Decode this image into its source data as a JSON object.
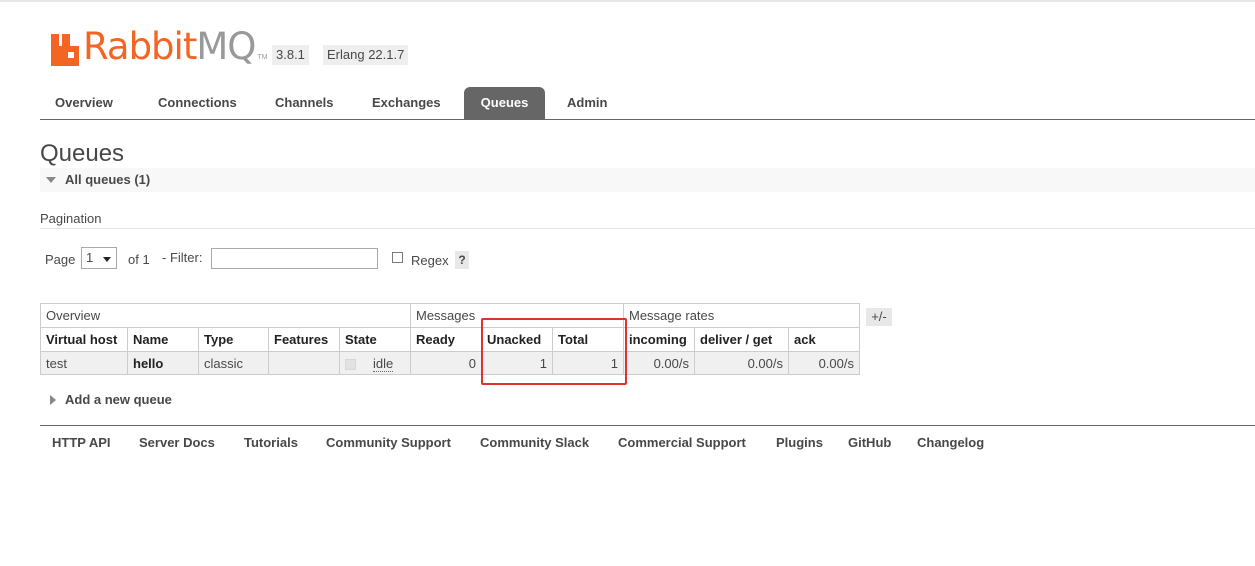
{
  "brand": {
    "name_part1": "Rabbit",
    "name_part2": "MQ",
    "trademark": "TM",
    "accent_color": "#f26522",
    "version": "3.8.1",
    "erlang": "Erlang 22.1.7"
  },
  "tabs": [
    {
      "label": "Overview",
      "active": false
    },
    {
      "label": "Connections",
      "active": false
    },
    {
      "label": "Channels",
      "active": false
    },
    {
      "label": "Exchanges",
      "active": false
    },
    {
      "label": "Queues",
      "active": true
    },
    {
      "label": "Admin",
      "active": false
    }
  ],
  "page": {
    "title": "Queues",
    "section": "All queues (1)",
    "pagination_label": "Pagination"
  },
  "filter": {
    "page_label": "Page",
    "page_value": "1",
    "of_label": "of 1",
    "filter_label": "- Filter:",
    "filter_value": "",
    "regex_label": "Regex",
    "regex_checked": false,
    "help": "?"
  },
  "table": {
    "groups": [
      "Overview",
      "Messages",
      "Message rates"
    ],
    "columns": [
      "Virtual host",
      "Name",
      "Type",
      "Features",
      "State",
      "Ready",
      "Unacked",
      "Total",
      "incoming",
      "deliver / get",
      "ack"
    ],
    "rows": [
      {
        "vhost": "test",
        "name": "hello",
        "type": "classic",
        "features": "",
        "state": "idle",
        "ready": "0",
        "unacked": "1",
        "total": "1",
        "incoming": "0.00/s",
        "deliver_get": "0.00/s",
        "ack": "0.00/s"
      }
    ],
    "toggle_columns": "+/-"
  },
  "add_queue": "Add a new queue",
  "footer": [
    "HTTP API",
    "Server Docs",
    "Tutorials",
    "Community Support",
    "Community Slack",
    "Commercial Support",
    "Plugins",
    "GitHub",
    "Changelog"
  ],
  "highlight_color": "#e03131"
}
